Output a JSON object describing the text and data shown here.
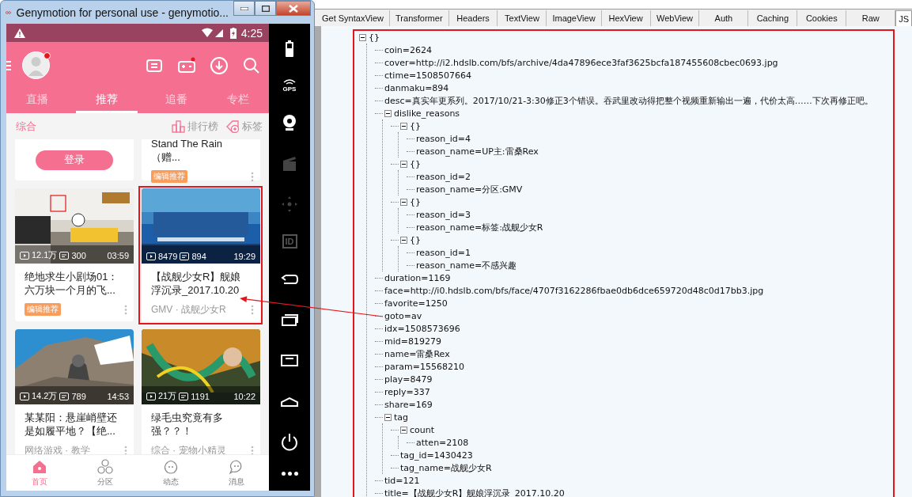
{
  "window": {
    "title": "Genymotion for personal use - genymotio..."
  },
  "phone": {
    "status_bar": {
      "time": "4:25"
    },
    "tabs": [
      {
        "label": "直播",
        "selected": false
      },
      {
        "label": "推荐",
        "selected": true
      },
      {
        "label": "追番",
        "selected": false
      },
      {
        "label": "专栏",
        "selected": false
      }
    ],
    "section": {
      "title": "综合",
      "actions": [
        {
          "label": "排行榜"
        },
        {
          "label": "标签"
        }
      ]
    },
    "cards": [
      {
        "kind": "login",
        "button": "登录"
      },
      {
        "kind": "text",
        "title": "Stand The Rain（赠...",
        "tag": "编辑推荐"
      },
      {
        "kind": "video",
        "plays": "12.1万",
        "danmaku": "300",
        "duration": "03:59",
        "title": "绝地求生小剧场01：六万块一个月的飞...",
        "tag": "编辑推荐",
        "highlighted": false
      },
      {
        "kind": "video",
        "plays": "8479",
        "danmaku": "894",
        "duration": "19:29",
        "title": "【战舰少女R】舰娘浮沉录_2017.10.20",
        "meta": "GMV · 战舰少女R",
        "highlighted": true
      },
      {
        "kind": "video",
        "plays": "14.2万",
        "danmaku": "789",
        "duration": "14:53",
        "title": "某某阳：悬崖峭壁还是如履平地？【绝...",
        "meta": "网络游戏 · 教学",
        "highlighted": false
      },
      {
        "kind": "video",
        "plays": "21万",
        "danmaku": "1191",
        "duration": "10:22",
        "title": "绿毛虫究竟有多强？？！",
        "meta": "综合 · 宠物小精灵",
        "highlighted": false
      }
    ],
    "bottom_nav": [
      {
        "label": "首页",
        "selected": true
      },
      {
        "label": "分区",
        "selected": false
      },
      {
        "label": "动态",
        "selected": false
      },
      {
        "label": "消息",
        "selected": false
      }
    ]
  },
  "emulator_bar": {
    "gps_label": "GPS",
    "id_label": "ID"
  },
  "inspector": {
    "tabs": [
      {
        "label": "Get SyntaxView",
        "selected": false
      },
      {
        "label": "Transformer",
        "selected": false
      },
      {
        "label": "Headers",
        "selected": false
      },
      {
        "label": "TextView",
        "selected": false
      },
      {
        "label": "ImageView",
        "selected": false
      },
      {
        "label": "HexView",
        "selected": false
      },
      {
        "label": "WebView",
        "selected": false
      },
      {
        "label": "Auth",
        "selected": false
      },
      {
        "label": "Caching",
        "selected": false
      },
      {
        "label": "Cookies",
        "selected": false
      },
      {
        "label": "Raw",
        "selected": false
      },
      {
        "label": "JS",
        "selected": true
      }
    ],
    "highlighted": true,
    "tree": {
      "label": "{}",
      "expanded": true,
      "children": [
        {
          "label": "coin=2624"
        },
        {
          "label": "cover=http://i2.hdslb.com/bfs/archive/4da47896ece3faf3625bcfa187455608cbec0693.jpg"
        },
        {
          "label": "ctime=1508507664"
        },
        {
          "label": "danmaku=894"
        },
        {
          "label": "desc=真实年更系列。2017/10/21-3:30修正3个错误。吞武里改动得把整个视频重新输出一遍，代价太高……下次再修正吧。"
        },
        {
          "label": "dislike_reasons",
          "expanded": true,
          "children": [
            {
              "label": "{}",
              "expanded": true,
              "children": [
                {
                  "label": "reason_id=4"
                },
                {
                  "label": "reason_name=UP主:雷桑Rex"
                }
              ]
            },
            {
              "label": "{}",
              "expanded": true,
              "children": [
                {
                  "label": "reason_id=2"
                },
                {
                  "label": "reason_name=分区:GMV"
                }
              ]
            },
            {
              "label": "{}",
              "expanded": true,
              "children": [
                {
                  "label": "reason_id=3"
                },
                {
                  "label": "reason_name=标签:战舰少女R"
                }
              ]
            },
            {
              "label": "{}",
              "expanded": true,
              "children": [
                {
                  "label": "reason_id=1"
                },
                {
                  "label": "reason_name=不感兴趣"
                }
              ]
            }
          ]
        },
        {
          "label": "duration=1169"
        },
        {
          "label": "face=http://i0.hdslb.com/bfs/face/4707f3162286fbae0db6dce659720d48c0d17bb3.jpg"
        },
        {
          "label": "favorite=1250"
        },
        {
          "label": "goto=av"
        },
        {
          "label": "idx=1508573696"
        },
        {
          "label": "mid=819279"
        },
        {
          "label": "name=雷桑Rex"
        },
        {
          "label": "param=15568210"
        },
        {
          "label": "play=8479"
        },
        {
          "label": "reply=337"
        },
        {
          "label": "share=169"
        },
        {
          "label": "tag",
          "expanded": true,
          "children": [
            {
              "label": "count",
              "expanded": true,
              "children": [
                {
                  "label": "atten=2108"
                }
              ]
            },
            {
              "label": "tag_id=1430423"
            },
            {
              "label": "tag_name=战舰少女R"
            }
          ]
        },
        {
          "label": "tid=121"
        },
        {
          "label": "title=【战舰少女R】舰娘浮沉录_2017.10.20"
        }
      ]
    }
  },
  "annotations": [
    {
      "kind": "box"
    },
    {
      "kind": "arrow"
    }
  ]
}
